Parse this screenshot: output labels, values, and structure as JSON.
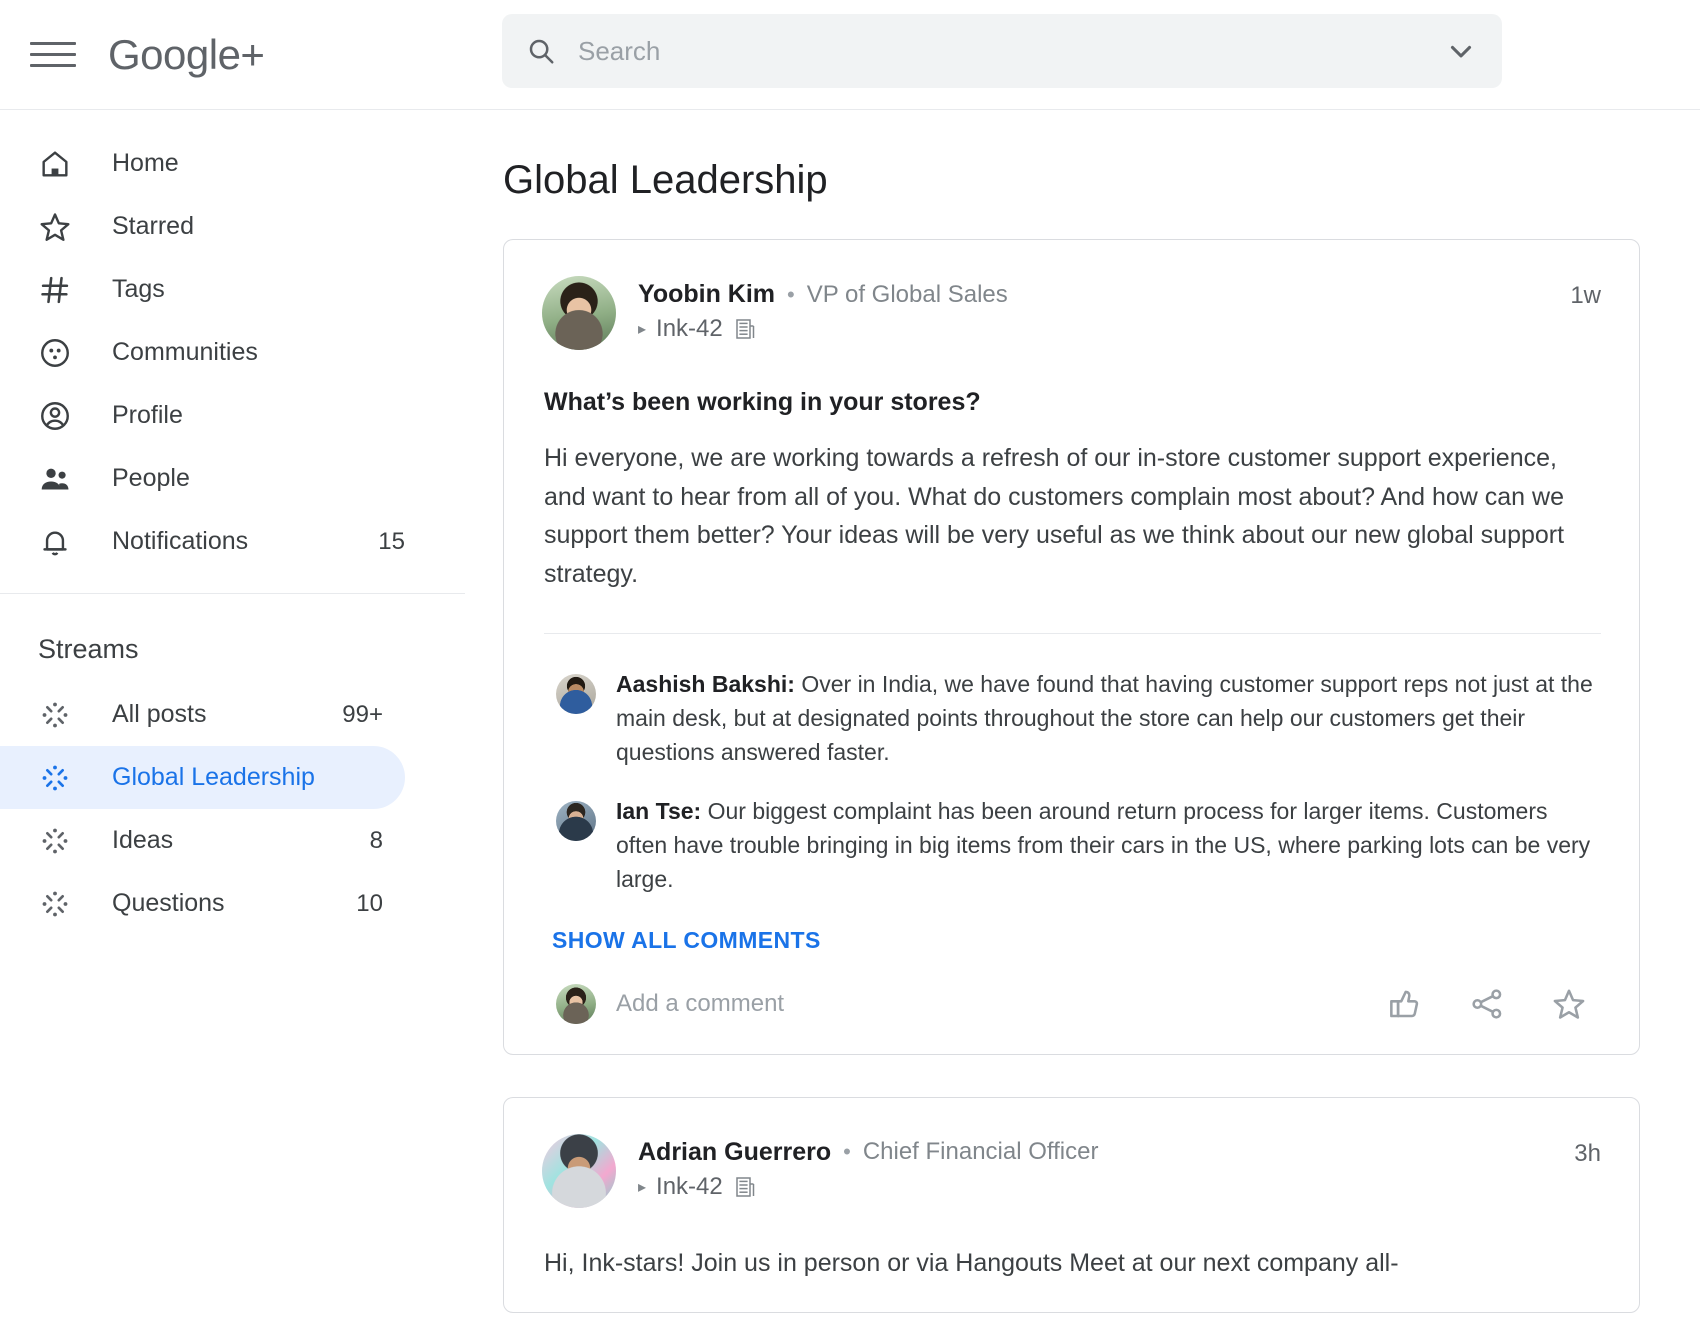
{
  "header": {
    "brand": "Google+",
    "menu_icon": "hamburger-icon",
    "search": {
      "placeholder": "Search",
      "value": "",
      "icon": "search-icon",
      "expand_icon": "chevron-down-icon"
    }
  },
  "sidebar": {
    "nav": [
      {
        "label": "Home",
        "icon": "home-icon",
        "count": ""
      },
      {
        "label": "Starred",
        "icon": "star-icon",
        "count": ""
      },
      {
        "label": "Tags",
        "icon": "hashtag-icon",
        "count": ""
      },
      {
        "label": "Communities",
        "icon": "communities-icon",
        "count": ""
      },
      {
        "label": "Profile",
        "icon": "profile-icon",
        "count": ""
      },
      {
        "label": "People",
        "icon": "people-icon",
        "count": ""
      },
      {
        "label": "Notifications",
        "icon": "bell-icon",
        "count": "15"
      }
    ],
    "streams_heading": "Streams",
    "streams": [
      {
        "label": "All posts",
        "count": "99+",
        "active": false,
        "icon": "burst-icon"
      },
      {
        "label": "Global Leadership",
        "count": "",
        "active": true,
        "icon": "burst-icon"
      },
      {
        "label": "Ideas",
        "count": "8",
        "active": false,
        "icon": "burst-icon"
      },
      {
        "label": "Questions",
        "count": "10",
        "active": false,
        "icon": "burst-icon"
      }
    ],
    "active_color": "#1a73e8",
    "active_bg": "#e8f0fe"
  },
  "main": {
    "page_title": "Global Leadership",
    "post1": {
      "author": "Yoobin Kim",
      "separator": "•",
      "role": "VP of Global Sales",
      "group_marker": "▸",
      "group": "Ink-42",
      "group_icon": "building-icon",
      "age": "1w",
      "title": "What’s been working in your stores?",
      "body": "Hi everyone, we are working towards a refresh of our in-store customer support experience, and want to hear from all of you. What do customers complain most about? And how can we support them better? Your ideas will be very useful as we think about our new global support strategy.",
      "comments": [
        {
          "name": "Aashish Bakshi:",
          "text": " Over in India, we have found that having customer support reps not just at the main desk, but at designated points throughout the store can help our customers get their questions answered faster."
        },
        {
          "name": "Ian Tse:",
          "text": " Our biggest complaint has been around return process for larger items. Customers often have trouble bringing in big items from their cars in the US, where parking lots can be very large."
        }
      ],
      "show_all_comments": "SHOW ALL COMMENTS",
      "comment_placeholder": "Add a comment",
      "actions": [
        {
          "icon": "thumbs-up-icon",
          "label": "Like"
        },
        {
          "icon": "share-icon",
          "label": "Share"
        },
        {
          "icon": "star-icon",
          "label": "Star"
        }
      ]
    },
    "post2": {
      "author": "Adrian Guerrero",
      "separator": "•",
      "role": "Chief Financial Officer",
      "group_marker": "▸",
      "group": "Ink-42",
      "group_icon": "building-icon",
      "age": "3h",
      "body": "Hi, Ink-stars! Join us in person or via Hangouts Meet at our next company all-"
    }
  }
}
